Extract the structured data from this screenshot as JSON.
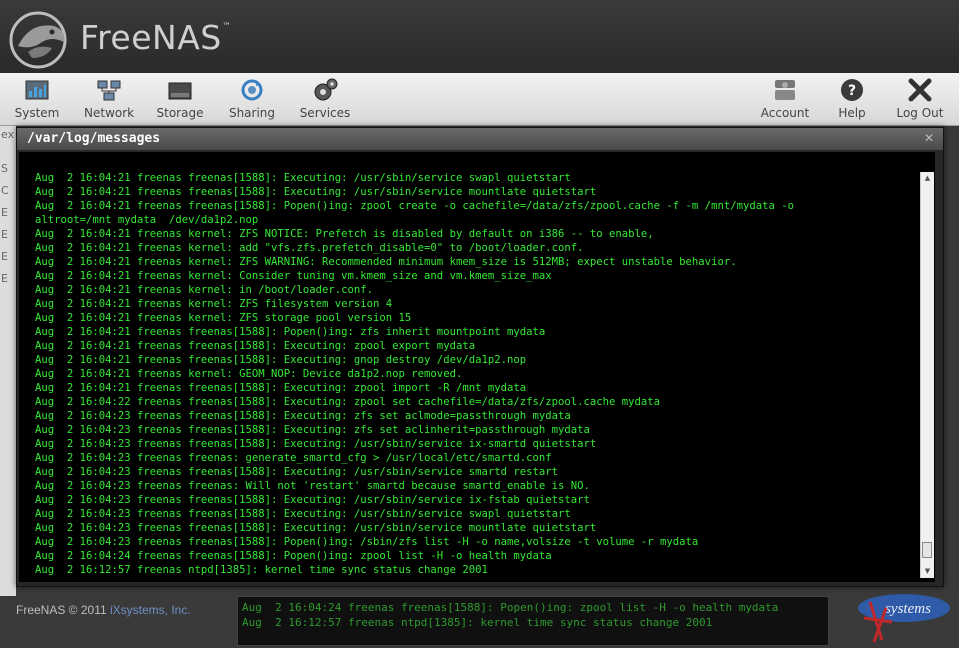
{
  "header": {
    "logo_text": "FreeNAS",
    "logo_tm": "™"
  },
  "toolbar": {
    "left": [
      {
        "label": "System",
        "icon": "system-icon"
      },
      {
        "label": "Network",
        "icon": "network-icon"
      },
      {
        "label": "Storage",
        "icon": "storage-icon"
      },
      {
        "label": "Sharing",
        "icon": "sharing-icon"
      },
      {
        "label": "Services",
        "icon": "services-icon"
      }
    ],
    "right": [
      {
        "label": "Account",
        "icon": "account-icon"
      },
      {
        "label": "Help",
        "icon": "help-icon"
      },
      {
        "label": "Log Out",
        "icon": "logout-icon"
      }
    ]
  },
  "dialog": {
    "title": "/var/log/messages",
    "close_glyph": "✕",
    "log_lines": [
      "Aug  2 16:04:21 freenas freenas[1588]: Executing: /usr/sbin/service swapl quietstart",
      "Aug  2 16:04:21 freenas freenas[1588]: Executing: /usr/sbin/service mountlate quietstart",
      "Aug  2 16:04:21 freenas freenas[1588]: Popen()ing: zpool create -o cachefile=/data/zfs/zpool.cache -f -m /mnt/mydata -o",
      "altroot=/mnt mydata  /dev/da1p2.nop",
      "Aug  2 16:04:21 freenas kernel: ZFS NOTICE: Prefetch is disabled by default on i386 -- to enable,",
      "Aug  2 16:04:21 freenas kernel: add \"vfs.zfs.prefetch_disable=0\" to /boot/loader.conf.",
      "Aug  2 16:04:21 freenas kernel: ZFS WARNING: Recommended minimum kmem_size is 512MB; expect unstable behavior.",
      "Aug  2 16:04:21 freenas kernel: Consider tuning vm.kmem_size and vm.kmem_size_max",
      "Aug  2 16:04:21 freenas kernel: in /boot/loader.conf.",
      "Aug  2 16:04:21 freenas kernel: ZFS filesystem version 4",
      "Aug  2 16:04:21 freenas kernel: ZFS storage pool version 15",
      "Aug  2 16:04:21 freenas freenas[1588]: Popen()ing: zfs inherit mountpoint mydata",
      "Aug  2 16:04:21 freenas freenas[1588]: Executing: zpool export mydata",
      "Aug  2 16:04:21 freenas freenas[1588]: Executing: gnop destroy /dev/da1p2.nop",
      "Aug  2 16:04:21 freenas kernel: GEOM_NOP: Device da1p2.nop removed.",
      "Aug  2 16:04:21 freenas freenas[1588]: Executing: zpool import -R /mnt mydata",
      "Aug  2 16:04:22 freenas freenas[1588]: Executing: zpool set cachefile=/data/zfs/zpool.cache mydata",
      "Aug  2 16:04:23 freenas freenas[1588]: Executing: zfs set aclmode=passthrough mydata",
      "Aug  2 16:04:23 freenas freenas[1588]: Executing: zfs set aclinherit=passthrough mydata",
      "Aug  2 16:04:23 freenas freenas[1588]: Executing: /usr/sbin/service ix-smartd quietstart",
      "Aug  2 16:04:23 freenas freenas: generate_smartd_cfg > /usr/local/etc/smartd.conf",
      "Aug  2 16:04:23 freenas freenas[1588]: Executing: /usr/sbin/service smartd restart",
      "Aug  2 16:04:23 freenas freenas: Will not 'restart' smartd because smartd_enable is NO.",
      "Aug  2 16:04:23 freenas freenas[1588]: Executing: /usr/sbin/service ix-fstab quietstart",
      "Aug  2 16:04:23 freenas freenas[1588]: Executing: /usr/sbin/service swapl quietstart",
      "Aug  2 16:04:23 freenas freenas[1588]: Executing: /usr/sbin/service mountlate quietstart",
      "Aug  2 16:04:23 freenas freenas[1588]: Popen()ing: /sbin/zfs list -H -o name,volsize -t volume -r mydata",
      "Aug  2 16:04:24 freenas freenas[1588]: Popen()ing: zpool list -H -o health mydata",
      "Aug  2 16:12:57 freenas ntpd[1385]: kernel time sync status change 2001"
    ]
  },
  "background": {
    "left_glyphs": [
      "ex",
      "S",
      "C",
      "E",
      "E",
      "E",
      "E"
    ],
    "footer_copy": "FreeNAS © 2011 ",
    "footer_link": "iXsystems, Inc.",
    "console_lines": [
      "Aug  2 16:04:24 freenas freenas[1588]: Popen()ing: zpool list -H -o health mydata",
      "Aug  2 16:12:57 freenas ntpd[1385]: kernel time sync status change 2001"
    ],
    "ixsystems_logo": "systems"
  },
  "colors": {
    "log_text": "#35e835",
    "log_bg": "#000000",
    "toolbar_bg": "#e4e4e4",
    "header_bg": "#333333"
  }
}
